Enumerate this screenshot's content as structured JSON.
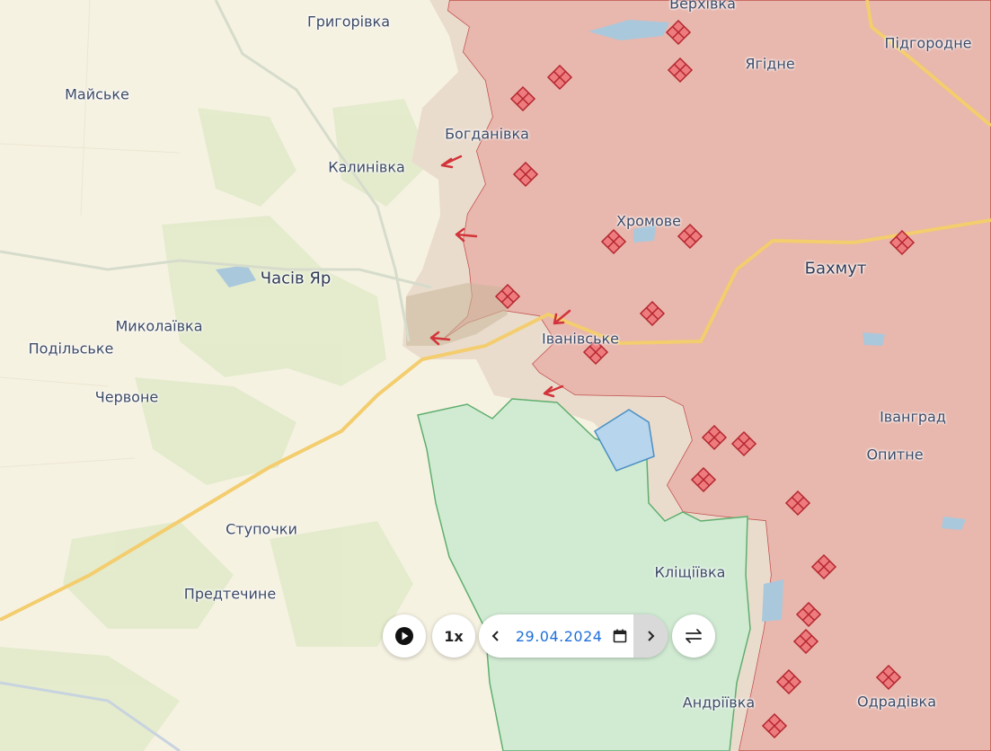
{
  "places": [
    {
      "id": "verkhivka",
      "name": "Верхівка"
    },
    {
      "id": "hryhorivka",
      "name": "Григорівка"
    },
    {
      "id": "pidhorodne",
      "name": "Підгородне"
    },
    {
      "id": "maiske",
      "name": "Майське"
    },
    {
      "id": "yahidne",
      "name": "Ягідне"
    },
    {
      "id": "bohdanivka",
      "name": "Богданівка"
    },
    {
      "id": "kalynivka",
      "name": "Калинівка"
    },
    {
      "id": "khromove",
      "name": "Хромове"
    },
    {
      "id": "bakhmut",
      "name": "Бахмут"
    },
    {
      "id": "chasiv-yar",
      "name": "Часів Яр"
    },
    {
      "id": "mykolaivka",
      "name": "Миколаївка"
    },
    {
      "id": "ivanivske",
      "name": "Іванівське"
    },
    {
      "id": "podilske",
      "name": "Подільське"
    },
    {
      "id": "chervone",
      "name": "Червоне"
    },
    {
      "id": "ivanhrad",
      "name": "Іванград"
    },
    {
      "id": "opytne",
      "name": "Опитне"
    },
    {
      "id": "stupochky",
      "name": "Ступочки"
    },
    {
      "id": "klishchiivka",
      "name": "Кліщіївка"
    },
    {
      "id": "predtechyne",
      "name": "Предтечине"
    },
    {
      "id": "andriivka",
      "name": "Андріївка"
    },
    {
      "id": "odradivka",
      "name": "Одрадівка"
    }
  ],
  "controls": {
    "play_icon": "play-icon",
    "speed_label": "1x",
    "prev_icon": "chevron-left-icon",
    "date_value": "29.04.2024",
    "calendar_icon": "calendar-icon",
    "next_icon": "chevron-right-icon",
    "swap_icon": "swap-arrows-icon"
  },
  "colors": {
    "occupied": "#e8b7ad",
    "occupied_border": "#c0504d",
    "contested": "#eadccd",
    "liberated": "#d1ebd3",
    "liberated_border": "#5fae6e",
    "blue_zone": "#b7d5ec",
    "road_main": "#f3cd6e",
    "water": "#aac8dc",
    "marker": "#ee7b7e",
    "date_text": "#1e6fd9"
  }
}
